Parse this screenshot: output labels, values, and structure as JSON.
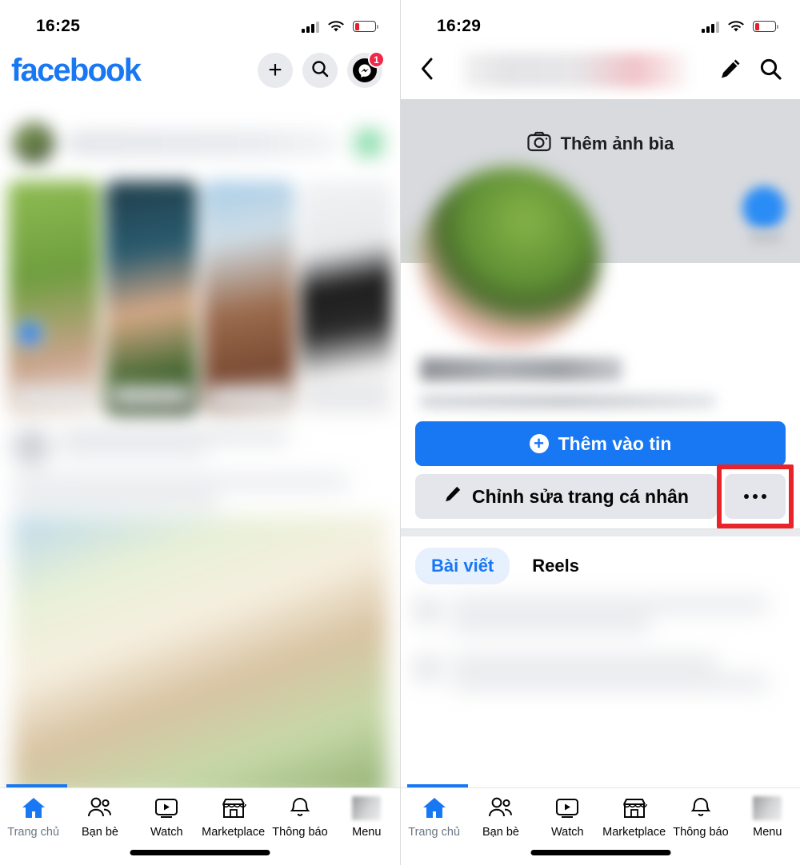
{
  "left_phone": {
    "status": {
      "time": "16:25",
      "battery_level_pct": 20
    },
    "appbar": {
      "logo_text": "facebook",
      "create_icon": "plus-icon",
      "search_icon": "search-icon",
      "messenger_icon": "messenger-icon",
      "messenger_badge": "1"
    },
    "content_note": "blurred news feed"
  },
  "right_phone": {
    "status": {
      "time": "16:29",
      "battery_level_pct": 20
    },
    "appbar": {
      "back_icon": "chevron-left-icon",
      "title_blurred": true,
      "edit_icon": "pencil-icon",
      "search_icon": "search-icon"
    },
    "cover": {
      "camera_icon": "camera-icon",
      "add_cover_label": "Thêm ảnh bìa"
    },
    "profile": {
      "avatar": "profile-avatar-blurred",
      "name_blurred": true,
      "bio_blurred": true
    },
    "actions": {
      "add_to_story_label": "Thêm vào tin",
      "add_icon": "plus-circle-icon",
      "edit_profile_label": "Chỉnh sửa trang cá nhân",
      "edit_profile_icon": "pencil-icon",
      "more_label": "•••",
      "more_icon": "ellipsis-icon",
      "highlight_color": "#e8232a"
    },
    "tabs": [
      {
        "label": "Bài viết",
        "active": true
      },
      {
        "label": "Reels",
        "active": false
      }
    ]
  },
  "bottom_nav": {
    "items": [
      {
        "label": "Trang chủ",
        "icon": "home-icon",
        "active": true
      },
      {
        "label": "Bạn bè",
        "icon": "friends-icon",
        "active": false
      },
      {
        "label": "Watch",
        "icon": "watch-icon",
        "active": false
      },
      {
        "label": "Marketplace",
        "icon": "marketplace-icon",
        "active": false
      },
      {
        "label": "Thông báo",
        "icon": "bell-icon",
        "active": false
      },
      {
        "label": "Menu",
        "icon": "menu-avatar-icon",
        "active": false
      }
    ]
  },
  "colors": {
    "facebook_blue": "#1877F2",
    "highlight_red": "#e8232a",
    "badge_red": "#f02849",
    "chip_bg": "#e7f0fd",
    "button_gray": "#e4e6eb"
  }
}
